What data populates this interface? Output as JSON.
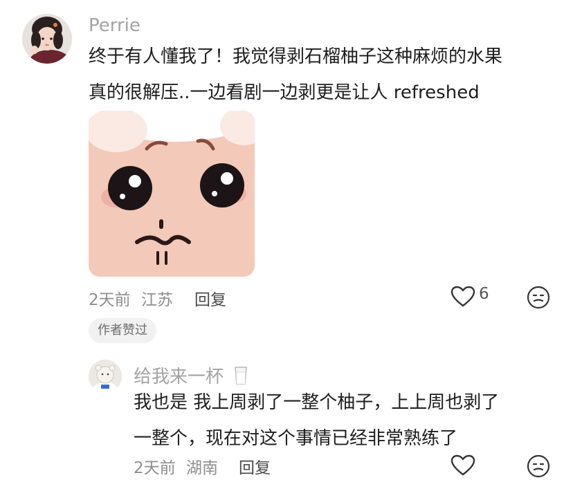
{
  "comment": {
    "username": "Perrie",
    "text_line1": "终于有人懂我了！我觉得剥石榴柚子这种麻烦的水果",
    "text_line2": "真的很解压..一边看剧一边剥更是让人 refreshed",
    "time": "2天前",
    "location": "江苏",
    "reply_label": "回复",
    "like_count": "6",
    "author_badge": "作者赞过",
    "like_icon": "heart-outline-icon",
    "dislike_icon": "meh-face-icon"
  },
  "reply": {
    "username": "给我来一杯",
    "username_emoji": "milk-glass-icon",
    "text_line1": "我也是 我上周剥了一整个柚子，上上周也剥了",
    "text_line2": "一整个，现在对这个事情已经非常熟练了",
    "time": "2天前",
    "location": "湖南",
    "reply_label": "回复"
  }
}
